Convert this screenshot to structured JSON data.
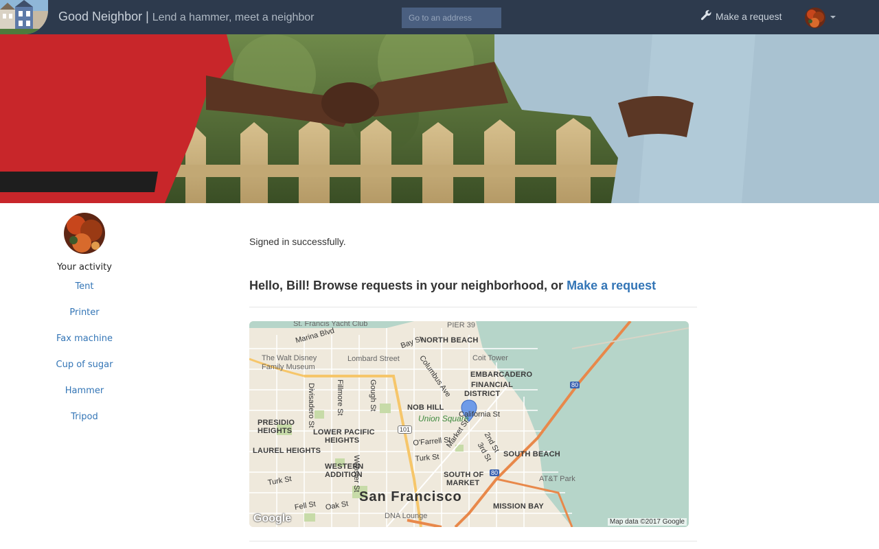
{
  "navbar": {
    "brand": "Good Neighbor |",
    "tagline": "Lend a hammer, meet a neighbor",
    "search_placeholder": "Go to an address",
    "make_request": "Make a request"
  },
  "sidebar": {
    "title": "Your activity",
    "items": [
      {
        "label": "Tent"
      },
      {
        "label": "Printer"
      },
      {
        "label": "Fax machine"
      },
      {
        "label": "Cup of sugar"
      },
      {
        "label": "Hammer"
      },
      {
        "label": "Tripod"
      }
    ]
  },
  "main": {
    "flash": "Signed in successfully.",
    "greeting": "Hello, Bill! Browse requests in your neighborhood, or",
    "make_request_link": "Make a request"
  },
  "map": {
    "labels": [
      {
        "text": "St. Francis Yacht Club",
        "cls": "poi"
      },
      {
        "text": "PIER 39",
        "cls": "poi"
      },
      {
        "text": "NORTH BEACH",
        "cls": "bold"
      },
      {
        "text": "Marina Blvd",
        "cls": ""
      },
      {
        "text": "Bay St",
        "cls": ""
      },
      {
        "text": "The Walt Disney",
        "cls": "poi"
      },
      {
        "text": "Family Museum",
        "cls": "poi"
      },
      {
        "text": "Lombard Street",
        "cls": "poi"
      },
      {
        "text": "Columbus Ave",
        "cls": ""
      },
      {
        "text": "Coit Tower",
        "cls": "poi"
      },
      {
        "text": "EMBARCADERO",
        "cls": "bold"
      },
      {
        "text": "FINANCIAL",
        "cls": "bold"
      },
      {
        "text": "DISTRICT",
        "cls": "bold"
      },
      {
        "text": "Divisadero St",
        "cls": ""
      },
      {
        "text": "Fillmore St",
        "cls": ""
      },
      {
        "text": "Gough St",
        "cls": ""
      },
      {
        "text": "NOB HILL",
        "cls": "bold"
      },
      {
        "text": "California St",
        "cls": ""
      },
      {
        "text": "Union Square",
        "cls": "green"
      },
      {
        "text": "PRESIDIO",
        "cls": "bold"
      },
      {
        "text": "HEIGHTS",
        "cls": "bold"
      },
      {
        "text": "LOWER PACIFIC",
        "cls": "bold"
      },
      {
        "text": "HEIGHTS",
        "cls": "bold"
      },
      {
        "text": "LAUREL HEIGHTS",
        "cls": "bold"
      },
      {
        "text": "O'Farrell St",
        "cls": ""
      },
      {
        "text": "2nd St",
        "cls": ""
      },
      {
        "text": "3rd St",
        "cls": ""
      },
      {
        "text": "SOUTH BEACH",
        "cls": "bold"
      },
      {
        "text": "Market St",
        "cls": ""
      },
      {
        "text": "Turk St",
        "cls": ""
      },
      {
        "text": "Webster St",
        "cls": ""
      },
      {
        "text": "WESTERN",
        "cls": "bold"
      },
      {
        "text": "ADDITION",
        "cls": "bold"
      },
      {
        "text": "SOUTH OF",
        "cls": "bold"
      },
      {
        "text": "MARKET",
        "cls": "bold"
      },
      {
        "text": "AT&T Park",
        "cls": "poi"
      },
      {
        "text": "Turk St",
        "cls": ""
      },
      {
        "text": "San Francisco",
        "cls": "big"
      },
      {
        "text": "Fell St",
        "cls": ""
      },
      {
        "text": "Oak St",
        "cls": ""
      },
      {
        "text": "DNA Lounge",
        "cls": "poi"
      },
      {
        "text": "MISSION BAY",
        "cls": "bold"
      }
    ],
    "shields": [
      "101",
      "80",
      "80"
    ],
    "google": "Google",
    "credit": "Map data ©2017 Google"
  },
  "colors": {
    "navbar_bg": "#2d3a4d",
    "link": "#3375b6",
    "water": "#b6d5c9",
    "land": "#efe9dc",
    "highway": "#e8884a",
    "arterial": "#f6c66a"
  }
}
